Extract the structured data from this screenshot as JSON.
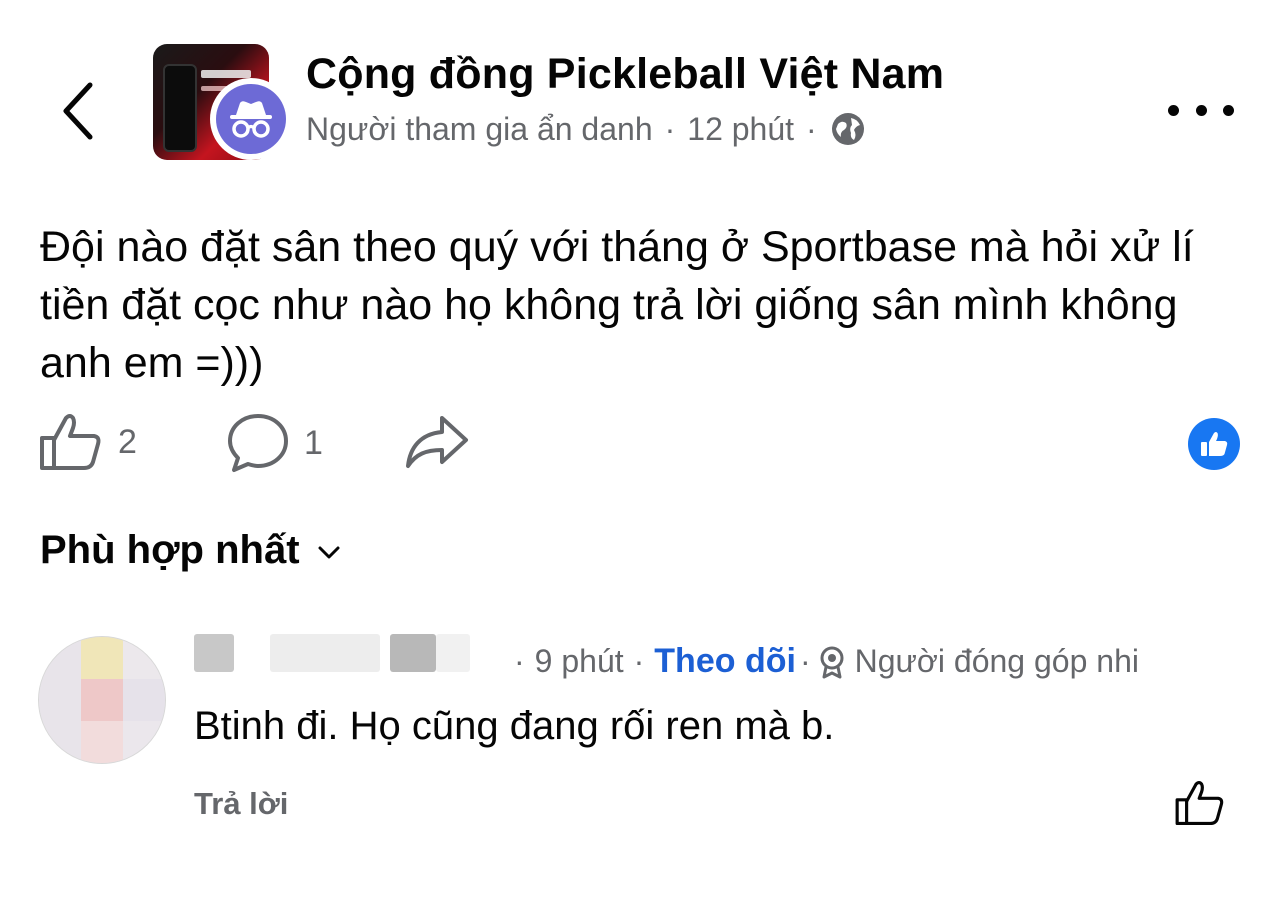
{
  "header": {
    "back_icon": "chevron-left-icon",
    "group_name": "Cộng đồng Pickleball Việt Nam",
    "author": "Người tham gia ẩn danh",
    "separator": "·",
    "time": "12 phút",
    "privacy_icon": "globe-icon",
    "more_icon": "more-horizontal-icon"
  },
  "post": {
    "text": "Đội nào đặt sân theo quý với tháng ở Sportbase mà hỏi xử lí tiền đặt cọc như nào họ không trả lời giống sân mình không anh em =)))",
    "like_count": "2",
    "comment_count": "1",
    "reaction_icon": "like-reaction-icon"
  },
  "sort": {
    "label": "Phù hợp nhất"
  },
  "comment": {
    "time": "9 phút",
    "separator": "·",
    "follow_label": "Theo dõi",
    "badge_label": "Người đóng góp nhi",
    "text": "Btinh đi. Họ cũng đang rối ren mà b.",
    "reply_label": "Trả lời"
  },
  "colors": {
    "text": "#050505",
    "secondary": "#65676b",
    "link": "#1c5fd4",
    "facebook_blue": "#1877f2",
    "anon_purple": "#6d6ad6"
  }
}
